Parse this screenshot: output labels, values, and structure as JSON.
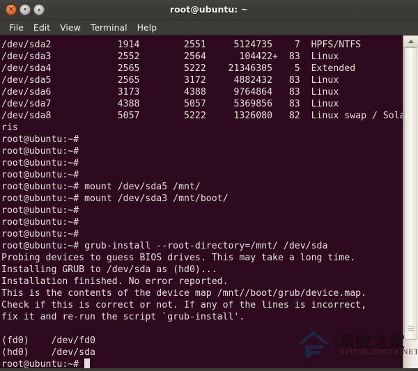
{
  "window": {
    "title": "root@ubuntu: ~",
    "controls": [
      {
        "name": "close",
        "glyph": "×"
      },
      {
        "name": "minimize",
        "glyph": "▾"
      },
      {
        "name": "maximize",
        "glyph": "▴"
      }
    ]
  },
  "menubar": {
    "items": [
      "File",
      "Edit",
      "View",
      "Terminal",
      "Help"
    ]
  },
  "colors": {
    "terminal_background": "#2e0a1e",
    "terminal_foreground": "#e6dedb",
    "titlebar_background": "#3c3b37",
    "close_button": "#e06c30",
    "scrollbar_track": "#ebe6dd"
  },
  "terminal": {
    "prompt": "root@ubuntu:~#",
    "cursor": "block",
    "lines": [
      "/dev/sda2            1914        2551     5124735    7  HPFS/NTFS",
      "/dev/sda3            2552        2564      104422+  83  Linux",
      "/dev/sda4            2565        5222    21346305    5  Extended",
      "/dev/sda5            2565        3172     4882432   83  Linux",
      "/dev/sda6            3173        4388     9764864   83  Linux",
      "/dev/sda7            4388        5057     5369856   83  Linux",
      "/dev/sda8            5057        5222     1326080   82  Linux swap / Sola",
      "ris",
      "root@ubuntu:~#",
      "root@ubuntu:~#",
      "root@ubuntu:~#",
      "root@ubuntu:~#",
      "root@ubuntu:~# mount /dev/sda5 /mnt/",
      "root@ubuntu:~# mount /dev/sda3 /mnt/boot/",
      "root@ubuntu:~#",
      "root@ubuntu:~#",
      "root@ubuntu:~#",
      "root@ubuntu:~# grub-install --root-directory=/mnt/ /dev/sda",
      "Probing devices to guess BIOS drives. This may take a long time.",
      "Installing GRUB to /dev/sda as (hd0)...",
      "Installation finished. No error reported.",
      "This is the contents of the device map /mnt//boot/grub/device.map.",
      "Check if this is correct or not. If any of the lines is incorrect,",
      "fix it and re-run the script `grub-install'.",
      "",
      "(fd0)    /dev/fd0",
      "(hd0)    /dev/sda"
    ],
    "last_line": "root@ubuntu:~# "
  },
  "watermark": {
    "chinese": "系统之家",
    "english": "XITONGZHIJIA.NET"
  }
}
